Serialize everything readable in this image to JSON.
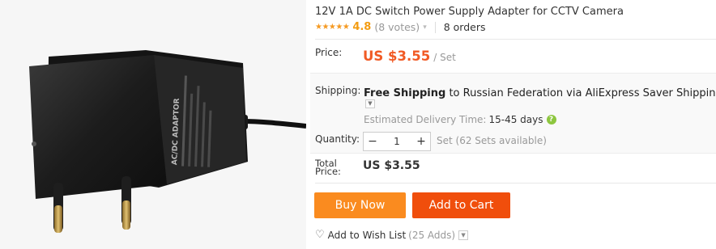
{
  "product": {
    "title": "12V 1A DC Switch Power Supply Adapter for CCTV Camera",
    "image_alt": "AC/DC adaptor power supply with EU plug",
    "image_label": "AC/DC ADAPTOR"
  },
  "rating": {
    "stars_glyph": "★★★★★",
    "value": "4.8",
    "votes": "(8 votes)",
    "orders": "8 orders"
  },
  "price": {
    "label": "Price:",
    "value": "US $3.55",
    "unit": "/ Set"
  },
  "shipping": {
    "label": "Shipping:",
    "text_bold": "Free Shipping",
    "text_rest": " to Russian Federation via AliExpress Saver Shipping",
    "eta_label": "Estimated Delivery Time:",
    "eta_value": "15-45 days"
  },
  "quantity": {
    "label": "Quantity:",
    "value": "1",
    "minus": "−",
    "plus": "+",
    "availability": "Set (62 Sets available)"
  },
  "total": {
    "label_line1": "Total",
    "label_line2": "Price:",
    "value": "US $3.55"
  },
  "actions": {
    "buy_now": "Buy Now",
    "add_to_cart": "Add to Cart",
    "wishlist_label": "Add to Wish List",
    "wishlist_count": "(25 Adds)"
  },
  "colors": {
    "price": "#f15a24",
    "rating": "#f39c12",
    "buy_now": "#fa8b1f",
    "add_to_cart": "#f04e0c",
    "help_icon": "#8dc63f"
  },
  "icons": [
    "star-icon",
    "chevron-down-icon",
    "help-icon",
    "heart-icon"
  ]
}
